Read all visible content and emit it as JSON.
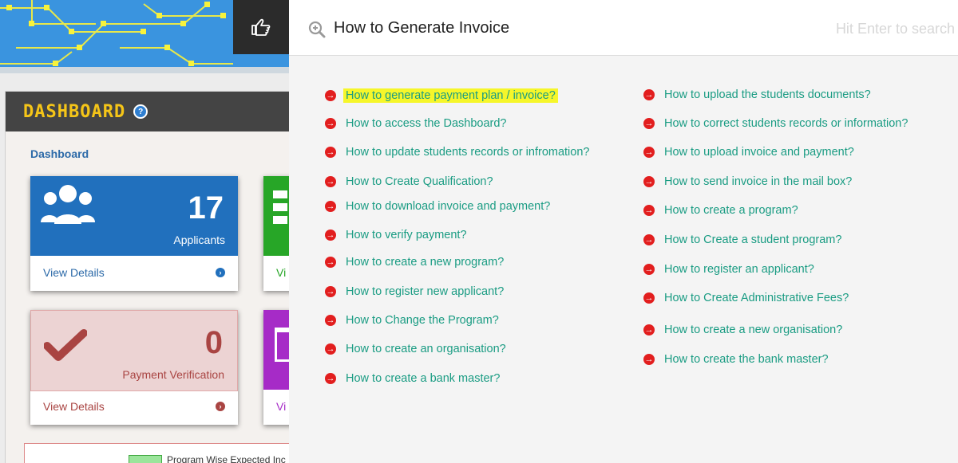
{
  "dashboard": {
    "title": "DASHBOARD",
    "help_icon": "question-circle-icon",
    "breadcrumb": "Dashboard",
    "cards": [
      {
        "value": "17",
        "label": "Applicants",
        "footer": "View Details",
        "icon": "users-icon",
        "color": "#2170bd"
      },
      {
        "value": "0",
        "label": "Payment Verification",
        "footer": "View Details",
        "icon": "checkmark-icon",
        "color": "#a94442"
      }
    ],
    "partial_card_labels": [
      "Vi",
      "Vi"
    ],
    "chart_legend": "Program Wise Expected Inc"
  },
  "help": {
    "search_title": "How to Generate Invoice",
    "search_placeholder": "Hit Enter to search",
    "highlighted_index": 0,
    "left_items": [
      "How to generate payment plan / invoice?",
      "How to access the Dashboard?",
      "How to update students records or infromation?",
      "How to Create Qualification?",
      "How to download invoice and payment?",
      "How to verify payment?",
      "How to create a new program?",
      "How to register new applicant?",
      "How to Change the Program?",
      "How to create an organisation?",
      "How to create a bank master?"
    ],
    "right_items": [
      "How to upload the students documents?",
      "How to correct students records or information?",
      "How to upload invoice and payment?",
      "How to send invoice in the mail box?",
      "How to create a program?",
      "How to Create a student program?",
      "How to register an applicant?",
      "How to Create Administrative Fees?",
      "How to create a new organisation?",
      "How to create the bank master?"
    ]
  },
  "colors": {
    "link": "#1a9c83",
    "bullet": "#e21e1e",
    "highlight": "#f6f62a",
    "dashboard_title": "#f5c518"
  }
}
